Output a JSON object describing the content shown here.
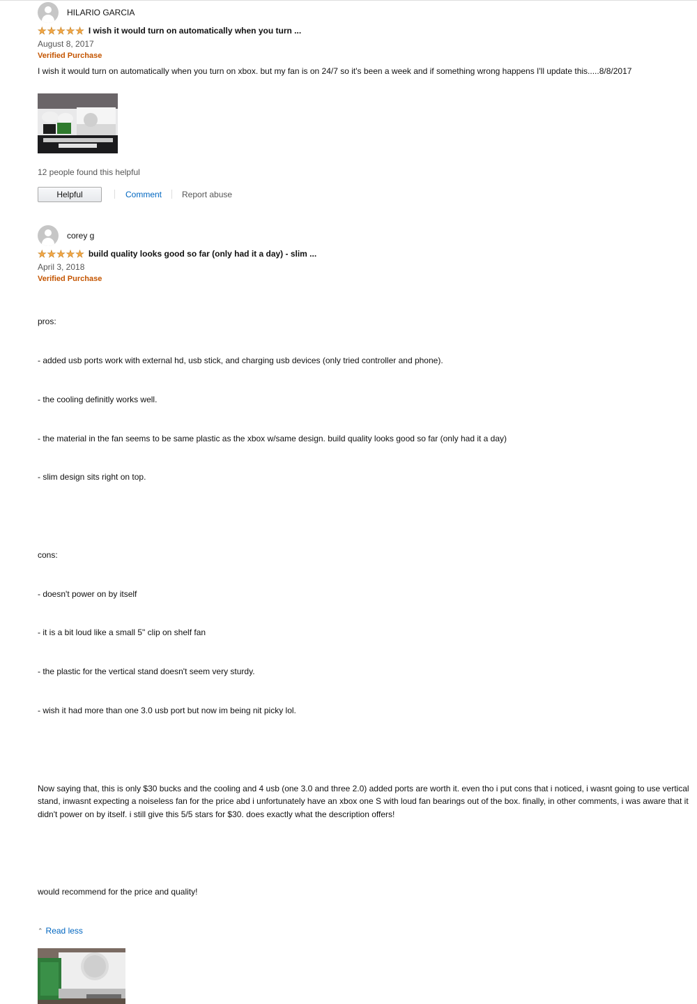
{
  "reviews": [
    {
      "author": "HILARIO GARCIA",
      "title": "I wish it would turn on automatically when you turn ...",
      "date": "August 8, 2017",
      "verified": "Verified Purchase",
      "body": "I wish it would turn on automatically when you turn on xbox. but my fan is on 24/7 so it's been a week and if something wrong happens I'll update this.....8/8/2017",
      "helpful_count": "12 people found this helpful",
      "helpful_button": "Helpful",
      "comment_link": "Comment",
      "report_link": "Report abuse",
      "rating": 5
    },
    {
      "author": "corey g",
      "title": "build quality looks good so far (only had it a day) - slim ...",
      "date": "April 3, 2018",
      "verified": "Verified Purchase",
      "body_lines": [
        "pros:",
        "- added usb ports work with external hd, usb stick, and charging usb devices (only tried controller and phone).",
        "- the cooling definitly works well.",
        "- the material in the fan seems to be same plastic as the xbox w/same design. build quality looks good so far (only had it a day)",
        "- slim design sits right on top.",
        "",
        "cons:",
        "- doesn't power on by itself",
        "- it is a bit loud like a small 5\" clip on shelf fan",
        "- the plastic for the vertical stand doesn't seem very sturdy.",
        "- wish it had more than one 3.0 usb port but now im being nit picky lol.",
        "",
        "Now saying that, this is only $30 bucks and the cooling and 4 usb (one 3.0 and three 2.0) added ports are worth it. even tho i put cons that i noticed, i wasnt going to use vertical stand, inwasnt expecting a noiseless fan for the price abd i unfortunately have an xbox one S with loud fan bearings out of the box. finally, in other comments, i was aware that it didn't power on by itself. i still give this 5/5 stars for $30. does exactly what the description offers!",
        "",
        "would recommend for the price and quality!"
      ],
      "read_less": "Read less",
      "rating": 5
    }
  ],
  "colors": {
    "star": "#f3a847",
    "verified": "#c45500",
    "link": "#0066c0"
  }
}
